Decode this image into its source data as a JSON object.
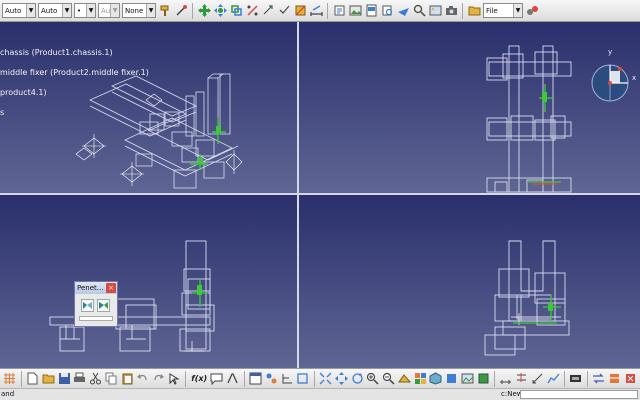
{
  "toolbar": {
    "combos": [
      {
        "name": "color-combo",
        "value": "Auto",
        "disabled": false
      },
      {
        "name": "transparency-combo",
        "value": "Auto",
        "disabled": false
      },
      {
        "name": "linetype-combo",
        "value": "•",
        "disabled": false
      },
      {
        "name": "lineweight-combo",
        "value": "Aut",
        "disabled": true
      },
      {
        "name": "layer-combo",
        "value": "None",
        "disabled": false
      }
    ],
    "file_combo": "File"
  },
  "tree": {
    "items": [
      "chassis (Product1.chassis.1)",
      "middle fixer (Product2.middle fixer.1)",
      "product4.1)",
      "s"
    ]
  },
  "compass": {
    "x_label": "x",
    "y_label": "y"
  },
  "panel": {
    "title": "Penet...",
    "close": "×"
  },
  "bottom": {
    "fx_label": "f(x)"
  },
  "status": {
    "message": "and",
    "command_label": "c:New",
    "command_value": ""
  },
  "colors": {
    "background": "#1e2458",
    "geometry": "#d9dcef",
    "accent": "#3ec83a",
    "compass": "#2c4b7e"
  }
}
